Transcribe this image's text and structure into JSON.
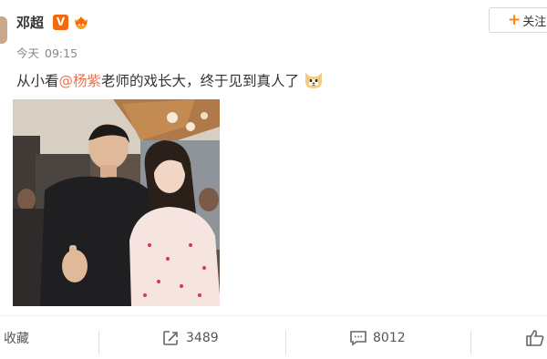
{
  "post": {
    "username": "邓超",
    "verified_badge": "V",
    "time_label": "今天",
    "time_value": "09:15",
    "follow_label": "关注",
    "text_before": "从小看",
    "mention": "@杨紫",
    "text_after": " 老师的戏长大，终于见到真人了"
  },
  "actions": {
    "favorite_label": "收藏",
    "repost_count": "3489",
    "comment_count": "8012"
  },
  "icons": [
    "verified-v-icon",
    "crown-badge-icon",
    "plus-icon",
    "dog-emoji-icon",
    "repost-icon",
    "comment-icon",
    "like-icon"
  ],
  "colors": {
    "mention": "#eb7350",
    "verified": "#f26a10",
    "follow_plus": "#ff8200"
  }
}
